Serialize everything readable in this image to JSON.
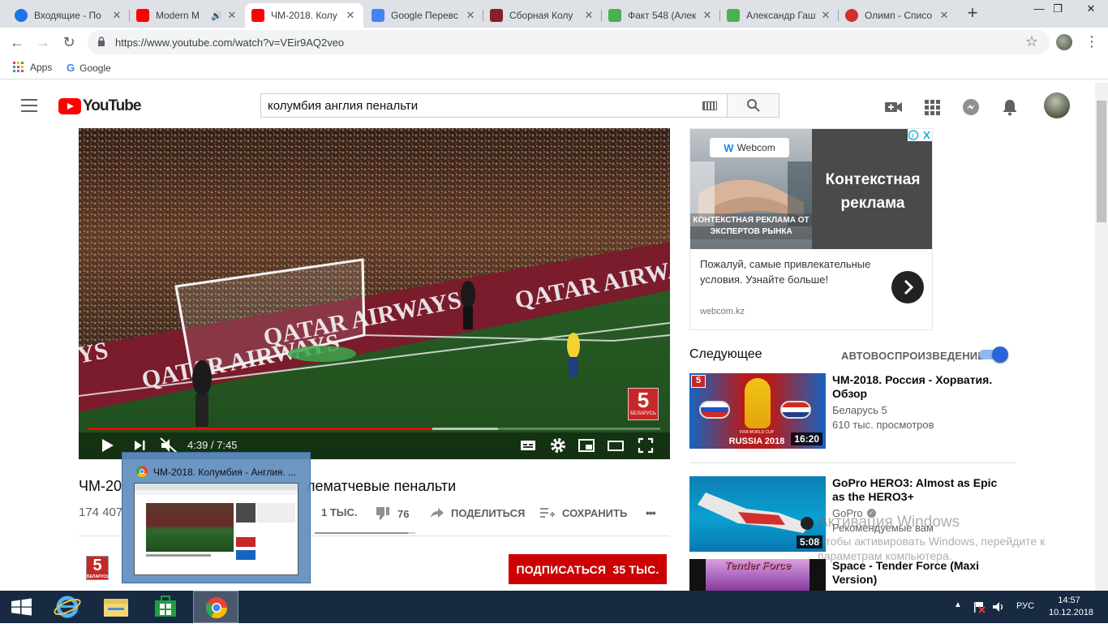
{
  "browser": {
    "tabs": [
      {
        "label": "Входящие - По",
        "favicon_color": "#1a73e8",
        "active": false
      },
      {
        "label": "Modern M",
        "favicon_color": "#ff0000",
        "active": false
      },
      {
        "label": "ЧМ-2018. Колу",
        "favicon_color": "#ff0000",
        "active": true
      },
      {
        "label": "Google Перевс",
        "favicon_color": "#4285f4",
        "active": false
      },
      {
        "label": "Сборная Колу",
        "favicon_color": "#8b1e2d",
        "active": false
      },
      {
        "label": "Факт 548 (Алек",
        "favicon_color": "#4caf50",
        "active": false
      },
      {
        "label": "Александр Гаш",
        "favicon_color": "#4caf50",
        "active": false
      },
      {
        "label": "Олимп - Списо",
        "favicon_color": "#d32f2f",
        "active": false
      }
    ],
    "url": "https://www.youtube.com/watch?v=VEir9AQ2veo",
    "bookmarks": [
      {
        "label": "Apps"
      },
      {
        "label": "Google"
      }
    ]
  },
  "youtube": {
    "logo_text": "YouTube",
    "search_query": "колумбия англия пенальти"
  },
  "player": {
    "time_display": "4:39 / 7:45",
    "played_fraction": 0.601,
    "buffered_fraction": 0.716,
    "channel_bug_number": "5",
    "channel_bug_text": "БЕЛАРУСЬ",
    "overlay_texts": [
      "QATAR AIRWAYS",
      "QATAR AIRWAYS",
      "QATAR AIRWAYS",
      "YS"
    ]
  },
  "video": {
    "title_start": "ЧМ-20",
    "title_end": "лематчевые пенальти",
    "views_partial": "174 407",
    "likes": "1 ТЫС.",
    "dislikes": "76",
    "share_label": "ПОДЕЛИТЬСЯ",
    "save_label": "СОХРАНИТЬ",
    "more_label": "•••",
    "sentiment_fraction": 0.93,
    "channel_logo_number": "5",
    "channel_logo_text": "БЕЛАРУСЬ",
    "subscribe_label": "ПОДПИСАТЬСЯ",
    "subscriber_count": "35 ТЫС."
  },
  "taskbar_preview": {
    "title": "ЧМ-2018. Колумбия - Англия. ..."
  },
  "ad": {
    "brand": "Webcom",
    "headline": "Контекстная реклама",
    "overlay_text": "КОНТЕКСТНАЯ РЕКЛАМА ОТ ЭКСПЕРТОВ РЫНКА",
    "body": "Пожалуй, самые привлекательные условия. Узнайте больше!",
    "domain": "webcom.kz"
  },
  "sidebar": {
    "up_next_label": "Следующее",
    "autoplay_label": "АВТОВОСПРОИЗВЕДЕНИЕ",
    "autoplay_on": true,
    "recommendations": [
      {
        "title": "ЧМ-2018. Россия - Хорватия. Обзор",
        "channel": "Беларусь 5",
        "views": "610 тыс. просмотров",
        "duration": "16:20",
        "thumb_text": "RUSSIA 2018",
        "thumb_sub": "FIFA WORLD CUP"
      },
      {
        "title": "GoPro HERO3: Almost as Epic as the HERO3+",
        "channel": "GoPro",
        "views": "Рекомендуемые вам",
        "duration": "5:08",
        "verified": true
      },
      {
        "title": "Space - Tender Force (Maxi Version)",
        "thumb_text": "Tender Force"
      }
    ]
  },
  "watermark": {
    "line1": "Активация Windows",
    "line2": "Чтобы активировать Windows, перейдите к параметрам компьютера."
  },
  "tray": {
    "language": "РУС",
    "time": "14:57",
    "date": "10.12.2018"
  }
}
